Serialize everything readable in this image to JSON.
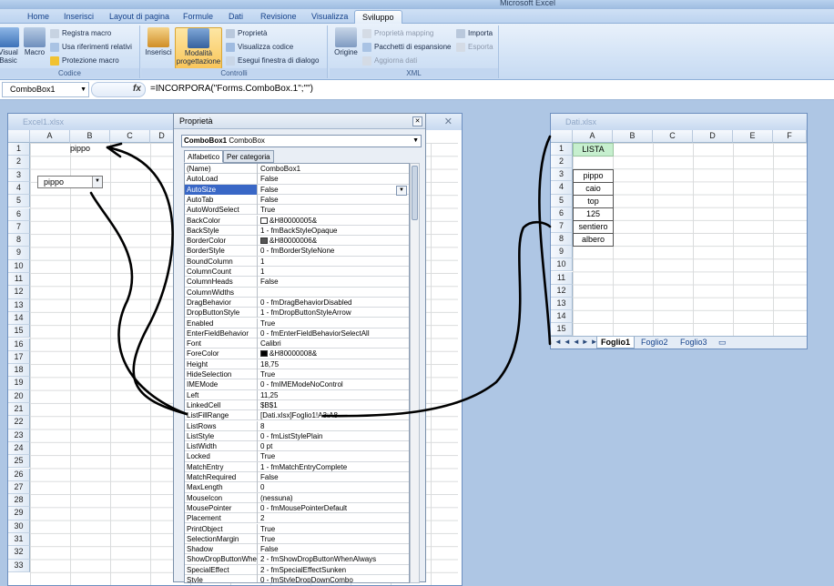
{
  "app": {
    "title": "Microsoft Excel"
  },
  "tabs": [
    "Home",
    "Inserisci",
    "Layout di pagina",
    "Formule",
    "Dati",
    "Revisione",
    "Visualizza",
    "Sviluppo"
  ],
  "ribbon": {
    "codice": {
      "label": "Codice",
      "visual_basic": "Visual Basic",
      "macro": "Macro",
      "registra": "Registra macro",
      "riferimenti": "Usa riferimenti relativi",
      "protezione": "Protezione macro"
    },
    "controlli": {
      "label": "Controlli",
      "inserisci": "Inserisci",
      "modalita": "Modalità progettazione",
      "proprieta": "Proprietà",
      "visualizza": "Visualizza codice",
      "esegui": "Esegui finestra di dialogo"
    },
    "xml": {
      "label": "XML",
      "origine": "Origine",
      "mapping": "Proprietà mapping",
      "pacchetti": "Pacchetti di espansione",
      "aggiorna": "Aggiorna dati",
      "importa": "Importa",
      "esporta": "Esporta"
    }
  },
  "formula_bar": {
    "name_box": "ComboBox1",
    "fx": "fx",
    "formula": "=INCORPORA(\"Forms.ComboBox.1\";\"\")"
  },
  "excel1": {
    "title": "Excel1.xlsx",
    "cols": [
      "A",
      "B",
      "C",
      "D"
    ],
    "rows": [
      "1",
      "2",
      "3",
      "4",
      "5",
      "6",
      "7",
      "8",
      "9",
      "10",
      "11",
      "12",
      "13",
      "14",
      "15",
      "16",
      "17",
      "18",
      "19",
      "20",
      "21",
      "22",
      "23",
      "24",
      "25",
      "26",
      "27",
      "28",
      "29",
      "30",
      "31",
      "32",
      "33"
    ],
    "b1": "pippo",
    "combobox": "pippo"
  },
  "dati": {
    "title": "Dati.xlsx",
    "cols": [
      "A",
      "B",
      "C",
      "D",
      "E",
      "F"
    ],
    "rows": [
      "1",
      "2",
      "3",
      "4",
      "5",
      "6",
      "7",
      "8",
      "9",
      "10",
      "11",
      "12",
      "13",
      "14",
      "15"
    ],
    "a1": "LISTA",
    "list": [
      "pippo",
      "caio",
      "top",
      "125",
      "sentiero",
      "albero"
    ],
    "sheets": [
      "Foglio1",
      "Foglio2",
      "Foglio3"
    ]
  },
  "properties": {
    "title": "Proprietà",
    "object": "ComboBox1",
    "object_type": "ComboBox",
    "tab_alpha": "Alfabetico",
    "tab_cat": "Per categoria",
    "rows": [
      [
        "(Name)",
        "ComboBox1"
      ],
      [
        "AutoLoad",
        "False"
      ],
      [
        "AutoSize",
        "False"
      ],
      [
        "AutoTab",
        "False"
      ],
      [
        "AutoWordSelect",
        "True"
      ],
      [
        "BackColor",
        "&H80000005&"
      ],
      [
        "BackStyle",
        "1 - fmBackStyleOpaque"
      ],
      [
        "BorderColor",
        "&H80000006&"
      ],
      [
        "BorderStyle",
        "0 - fmBorderStyleNone"
      ],
      [
        "BoundColumn",
        "1"
      ],
      [
        "ColumnCount",
        "1"
      ],
      [
        "ColumnHeads",
        "False"
      ],
      [
        "ColumnWidths",
        ""
      ],
      [
        "DragBehavior",
        "0 - fmDragBehaviorDisabled"
      ],
      [
        "DropButtonStyle",
        "1 - fmDropButtonStyleArrow"
      ],
      [
        "Enabled",
        "True"
      ],
      [
        "EnterFieldBehavior",
        "0 - fmEnterFieldBehaviorSelectAll"
      ],
      [
        "Font",
        "Calibri"
      ],
      [
        "ForeColor",
        "&H80000008&"
      ],
      [
        "Height",
        "18,75"
      ],
      [
        "HideSelection",
        "True"
      ],
      [
        "IMEMode",
        "0 - fmIMEModeNoControl"
      ],
      [
        "Left",
        "11,25"
      ],
      [
        "LinkedCell",
        "$B$1"
      ],
      [
        "ListFillRange",
        "[Dati.xlsx]Foglio1!A3:A8"
      ],
      [
        "ListRows",
        "8"
      ],
      [
        "ListStyle",
        "0 - fmListStylePlain"
      ],
      [
        "ListWidth",
        "0 pt"
      ],
      [
        "Locked",
        "True"
      ],
      [
        "MatchEntry",
        "1 - fmMatchEntryComplete"
      ],
      [
        "MatchRequired",
        "False"
      ],
      [
        "MaxLength",
        "0"
      ],
      [
        "MouseIcon",
        "(nessuna)"
      ],
      [
        "MousePointer",
        "0 - fmMousePointerDefault"
      ],
      [
        "Placement",
        "2"
      ],
      [
        "PrintObject",
        "True"
      ],
      [
        "SelectionMargin",
        "True"
      ],
      [
        "Shadow",
        "False"
      ],
      [
        "ShowDropButtonWhen",
        "2 - fmShowDropButtonWhenAlways"
      ],
      [
        "SpecialEffect",
        "2 - fmSpecialEffectSunken"
      ],
      [
        "Style",
        "0 - fmStyleDropDownCombo"
      ]
    ],
    "selected": "AutoSize"
  },
  "colors": {
    "accent": "#3967c6",
    "lista_fill": "#c6efce",
    "annotation": "#000000"
  }
}
